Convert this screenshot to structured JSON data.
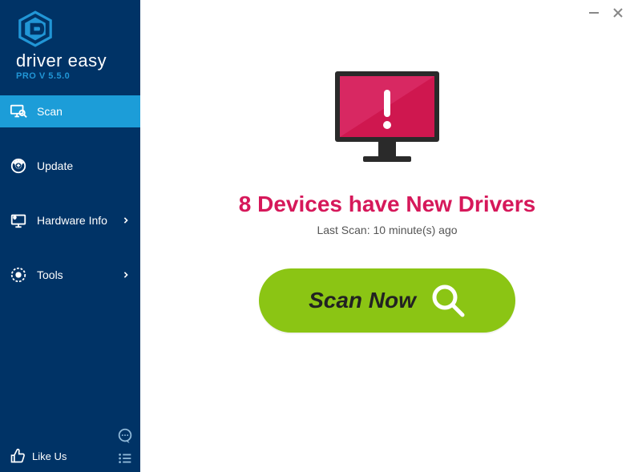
{
  "brand": {
    "name": "driver easy",
    "version": "PRO V 5.5.0"
  },
  "sidebar": {
    "items": [
      {
        "label": "Scan",
        "active": true,
        "has_chevron": false
      },
      {
        "label": "Update",
        "active": false,
        "has_chevron": false
      },
      {
        "label": "Hardware Info",
        "active": false,
        "has_chevron": true
      },
      {
        "label": "Tools",
        "active": false,
        "has_chevron": true
      }
    ],
    "like_label": "Like Us"
  },
  "main": {
    "headline": "8 Devices have New Drivers",
    "last_scan": "Last Scan: 10 minute(s) ago",
    "scan_button_label": "Scan Now"
  },
  "colors": {
    "sidebar_bg": "#003366",
    "active_bg": "#1c9dd8",
    "accent_blue": "#2196d6",
    "headline_pink": "#d6185a",
    "button_green": "#8bc514",
    "monitor_red": "#cf174f"
  }
}
